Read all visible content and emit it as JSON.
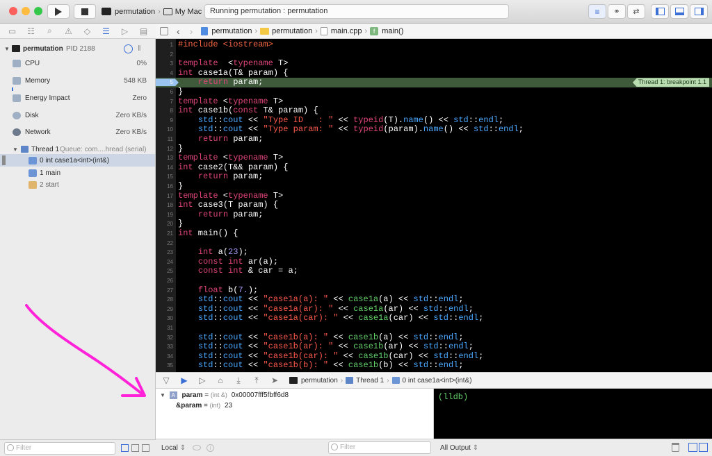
{
  "toolbar": {
    "scheme_target": "permutation",
    "scheme_device": "My Mac",
    "activity_status": "Running permutation : permutation",
    "traffic_colors": [
      "#fc605c",
      "#fdbc40",
      "#34c84a"
    ]
  },
  "navigator": {
    "process": {
      "name": "permutation",
      "pid": "PID 2188"
    },
    "gauges": [
      {
        "label": "CPU",
        "value": "0%"
      },
      {
        "label": "Memory",
        "value": "548 KB"
      },
      {
        "label": "Energy Impact",
        "value": "Zero"
      },
      {
        "label": "Disk",
        "value": "Zero KB/s"
      },
      {
        "label": "Network",
        "value": "Zero KB/s"
      }
    ],
    "thread": {
      "label": "Thread 1",
      "queue": "Queue: com....hread (serial)"
    },
    "frames": [
      "0 int case1a<int>(int&)",
      "1 main",
      "2 start"
    ],
    "filter_placeholder": "Filter"
  },
  "jumpbar": {
    "crumbs": [
      "permutation",
      "permutation",
      "main.cpp",
      "main()"
    ]
  },
  "editor": {
    "breakpoint_line": 5,
    "breakpoint_label": "Thread 1: breakpoint 1.1",
    "lines": [
      [
        [
          "pp",
          "#include <iostream>"
        ]
      ],
      [],
      [
        [
          "kw",
          "template"
        ],
        [
          "",
          "  <"
        ],
        [
          "kw",
          "typename"
        ],
        [
          "",
          " T>"
        ]
      ],
      [
        [
          "kw",
          "int"
        ],
        [
          "",
          " case1a(T& param) {"
        ]
      ],
      [
        [
          "",
          "    "
        ],
        [
          "kw",
          "return"
        ],
        [
          "",
          " param;"
        ]
      ],
      [
        [
          "",
          "}"
        ]
      ],
      [
        [
          "kw",
          "template"
        ],
        [
          "",
          " <"
        ],
        [
          "kw",
          "typename"
        ],
        [
          "",
          " T>"
        ]
      ],
      [
        [
          "kw",
          "int"
        ],
        [
          "",
          " case1b("
        ],
        [
          "kw",
          "const"
        ],
        [
          "",
          " T& param) {"
        ]
      ],
      [
        [
          "",
          "    "
        ],
        [
          "std",
          "std"
        ],
        [
          "",
          "::"
        ],
        [
          "std",
          "cout"
        ],
        [
          "",
          " << "
        ],
        [
          "str",
          "\"Type ID   : \""
        ],
        [
          "",
          " << "
        ],
        [
          "kw",
          "typeid"
        ],
        [
          "",
          "(T)."
        ],
        [
          "std",
          "name"
        ],
        [
          "",
          "() << "
        ],
        [
          "std",
          "std"
        ],
        [
          "",
          "::"
        ],
        [
          "std",
          "endl"
        ],
        [
          "",
          ";"
        ]
      ],
      [
        [
          "",
          "    "
        ],
        [
          "std",
          "std"
        ],
        [
          "",
          "::"
        ],
        [
          "std",
          "cout"
        ],
        [
          "",
          " << "
        ],
        [
          "str",
          "\"Type param: \""
        ],
        [
          "",
          " << "
        ],
        [
          "kw",
          "typeid"
        ],
        [
          "",
          "(param)."
        ],
        [
          "std",
          "name"
        ],
        [
          "",
          "() << "
        ],
        [
          "std",
          "std"
        ],
        [
          "",
          "::"
        ],
        [
          "std",
          "endl"
        ],
        [
          "",
          ";"
        ]
      ],
      [
        [
          "",
          "    "
        ],
        [
          "kw",
          "return"
        ],
        [
          "",
          " param;"
        ]
      ],
      [
        [
          "",
          "}"
        ]
      ],
      [
        [
          "kw",
          "template"
        ],
        [
          "",
          " <"
        ],
        [
          "kw",
          "typename"
        ],
        [
          "",
          " T>"
        ]
      ],
      [
        [
          "kw",
          "int"
        ],
        [
          "",
          " case2(T&& param) {"
        ]
      ],
      [
        [
          "",
          "    "
        ],
        [
          "kw",
          "return"
        ],
        [
          "",
          " param;"
        ]
      ],
      [
        [
          "",
          "}"
        ]
      ],
      [
        [
          "kw",
          "template"
        ],
        [
          "",
          " <"
        ],
        [
          "kw",
          "typename"
        ],
        [
          "",
          " T>"
        ]
      ],
      [
        [
          "kw",
          "int"
        ],
        [
          "",
          " case3(T param) {"
        ]
      ],
      [
        [
          "",
          "    "
        ],
        [
          "kw",
          "return"
        ],
        [
          "",
          " param;"
        ]
      ],
      [
        [
          "",
          "}"
        ]
      ],
      [
        [
          "kw",
          "int"
        ],
        [
          "",
          " main() {"
        ]
      ],
      [],
      [
        [
          "",
          "    "
        ],
        [
          "kw",
          "int"
        ],
        [
          "",
          " a("
        ],
        [
          "num",
          "23"
        ],
        [
          "",
          ");"
        ]
      ],
      [
        [
          "",
          "    "
        ],
        [
          "kw",
          "const"
        ],
        [
          "",
          " "
        ],
        [
          "kw",
          "int"
        ],
        [
          "",
          " ar(a);"
        ]
      ],
      [
        [
          "",
          "    "
        ],
        [
          "kw",
          "const"
        ],
        [
          "",
          " "
        ],
        [
          "kw",
          "int"
        ],
        [
          "",
          " & car = a;"
        ]
      ],
      [],
      [
        [
          "",
          "    "
        ],
        [
          "kw",
          "float"
        ],
        [
          "",
          " b("
        ],
        [
          "num",
          "7."
        ],
        [
          "",
          ");"
        ]
      ],
      [
        [
          "",
          "    "
        ],
        [
          "std",
          "std"
        ],
        [
          "",
          "::"
        ],
        [
          "std",
          "cout"
        ],
        [
          "",
          " << "
        ],
        [
          "str",
          "\"case1a(a): \""
        ],
        [
          "",
          " << "
        ],
        [
          "fn",
          "case1a"
        ],
        [
          "",
          "(a) << "
        ],
        [
          "std",
          "std"
        ],
        [
          "",
          "::"
        ],
        [
          "std",
          "endl"
        ],
        [
          "",
          ";"
        ]
      ],
      [
        [
          "",
          "    "
        ],
        [
          "std",
          "std"
        ],
        [
          "",
          "::"
        ],
        [
          "std",
          "cout"
        ],
        [
          "",
          " << "
        ],
        [
          "str",
          "\"case1a(ar): \""
        ],
        [
          "",
          " << "
        ],
        [
          "fn",
          "case1a"
        ],
        [
          "",
          "(ar) << "
        ],
        [
          "std",
          "std"
        ],
        [
          "",
          "::"
        ],
        [
          "std",
          "endl"
        ],
        [
          "",
          ";"
        ]
      ],
      [
        [
          "",
          "    "
        ],
        [
          "std",
          "std"
        ],
        [
          "",
          "::"
        ],
        [
          "std",
          "cout"
        ],
        [
          "",
          " << "
        ],
        [
          "str",
          "\"case1a(car): \""
        ],
        [
          "",
          " << "
        ],
        [
          "fn",
          "case1a"
        ],
        [
          "",
          "(car) << "
        ],
        [
          "std",
          "std"
        ],
        [
          "",
          "::"
        ],
        [
          "std",
          "endl"
        ],
        [
          "",
          ";"
        ]
      ],
      [],
      [
        [
          "",
          "    "
        ],
        [
          "std",
          "std"
        ],
        [
          "",
          "::"
        ],
        [
          "std",
          "cout"
        ],
        [
          "",
          " << "
        ],
        [
          "str",
          "\"case1b(a): \""
        ],
        [
          "",
          " << "
        ],
        [
          "fn",
          "case1b"
        ],
        [
          "",
          "(a) << "
        ],
        [
          "std",
          "std"
        ],
        [
          "",
          "::"
        ],
        [
          "std",
          "endl"
        ],
        [
          "",
          ";"
        ]
      ],
      [
        [
          "",
          "    "
        ],
        [
          "std",
          "std"
        ],
        [
          "",
          "::"
        ],
        [
          "std",
          "cout"
        ],
        [
          "",
          " << "
        ],
        [
          "str",
          "\"case1b(ar): \""
        ],
        [
          "",
          " << "
        ],
        [
          "fn",
          "case1b"
        ],
        [
          "",
          "(ar) << "
        ],
        [
          "std",
          "std"
        ],
        [
          "",
          "::"
        ],
        [
          "std",
          "endl"
        ],
        [
          "",
          ";"
        ]
      ],
      [
        [
          "",
          "    "
        ],
        [
          "std",
          "std"
        ],
        [
          "",
          "::"
        ],
        [
          "std",
          "cout"
        ],
        [
          "",
          " << "
        ],
        [
          "str",
          "\"case1b(car): \""
        ],
        [
          "",
          " << "
        ],
        [
          "fn",
          "case1b"
        ],
        [
          "",
          "(car) << "
        ],
        [
          "std",
          "std"
        ],
        [
          "",
          "::"
        ],
        [
          "std",
          "endl"
        ],
        [
          "",
          ";"
        ]
      ],
      [
        [
          "",
          "    "
        ],
        [
          "std",
          "std"
        ],
        [
          "",
          "::"
        ],
        [
          "std",
          "cout"
        ],
        [
          "",
          " << "
        ],
        [
          "str",
          "\"case1b(b): \""
        ],
        [
          "",
          " << "
        ],
        [
          "fn",
          "case1b"
        ],
        [
          "",
          "(b) << "
        ],
        [
          "std",
          "std"
        ],
        [
          "",
          "::"
        ],
        [
          "std",
          "endl"
        ],
        [
          "",
          ";"
        ]
      ]
    ]
  },
  "debugbar": {
    "crumbs": [
      "permutation",
      "Thread 1",
      "0 int case1a<int>(int&)"
    ]
  },
  "variables": [
    {
      "name": "param",
      "type": "(int &)",
      "value": "0x00007fff5fbff6d8"
    },
    {
      "name": "&param",
      "type": "(int)",
      "value": "23"
    }
  ],
  "variables_scope": "Local",
  "variables_filter_placeholder": "Filter",
  "console": {
    "prompt": "(lldb)",
    "output_selector": "All Output"
  },
  "colors": {
    "keyword": "#e0457b",
    "string": "#ff5a4e",
    "std": "#4aa8ff",
    "function": "#63d16a",
    "number": "#a79df5",
    "preprocessor": "#ff6a45",
    "breakpoint_line": "#3e5a3b",
    "annotation_arrow": "#ff22d8"
  }
}
